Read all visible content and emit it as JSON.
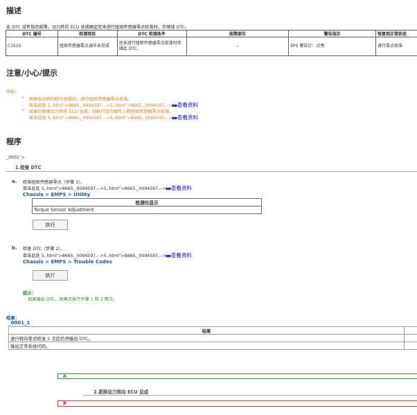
{
  "description": {
    "heading": "描述",
    "text": "此 DTC 没有指示故障。动力转向 ECU 总成确定还未进行扭矩传感器零点校准时，存储该 DTC。",
    "table": {
      "headers": [
        "DTC 编号",
        "检测项目",
        "DTC 检测条件",
        "故障部位",
        "警告指示",
        "恢复到正常状态"
      ],
      "row": [
        "C1515",
        "扭矩传感器零点调节未完成",
        "还未进行扭矩传感器零点校准时存储此 DTC。",
        "-",
        "EPS 警告灯：点亮",
        "进行零点校准"
      ]
    }
  },
  "caution": {
    "heading": "注意/小心/提示",
    "label": "小心：",
    "items": [
      {
        "line1": "更换齿动转向柱分总成后，进行扭矩传感器零点校准。",
        "line2": "单击此处 5,.html\">8665,_0094597,-->5,.html\">8665,_0094597,-->",
        "link": "查看资料"
      },
      {
        "line1": "如果已更换动力转向 ECU 总成，则执行动力图写入和扭矩传感器零点校准。",
        "line2": "单击此处 5,.html\">8665,_0094597,-->5,.html\">8665,_0094597,-->",
        "link": "查看资料"
      }
    ]
  },
  "procedure": {
    "heading": "程序",
    "fragment": "_0001\">",
    "step1_title": "1.检查 DTC",
    "step_a": {
      "marker": "a.",
      "line1": "校准扭矩传感器零点（步骤 1）。",
      "line2": "单击此处 5,.html\">8665,_0094597,-->5,.html\">8665,_0094597,-->",
      "link": "查看资料",
      "path": "Chassis > EMPS > Utility",
      "tester_header": "检测仪显示",
      "tester_value": "Torque Sensor Adjustment",
      "button": "执行"
    },
    "step_b": {
      "marker": "b.",
      "line1": "检查 DTC（步骤 2）。",
      "line2": "单击此处 5,.html\">8665,_0094597,-->5,.html\">8665,_0094597,-->",
      "link": "查看资料",
      "path": "Chassis > EMPS > Trouble Codes",
      "button": "执行"
    },
    "hint_label": "提示：",
    "hint_text": "如果输出 DTC，则再次执行步骤 1 和 2 两次。",
    "result_label": "结果：",
    "result_anchor": "_0001_1",
    "result_header": "结果",
    "results": [
      {
        "text": "进行转向零点校准 3 次后仍然输出 DTC。"
      },
      {
        "text": "输出正常系统代码。"
      }
    ],
    "branch_a": "A",
    "step2_title": "2.更换动力转向 ECU 总成",
    "branch_b": "B"
  },
  "colors": {
    "orange": "#e07a10",
    "link_blue": "#0000cc",
    "navy": "#1f4e8c",
    "green": "#2a8a2a",
    "branch_a": "#2a8a2a",
    "branch_b": "#dd2222"
  },
  "icons": {
    "link_arrow": "double-triangle-right-icon"
  }
}
